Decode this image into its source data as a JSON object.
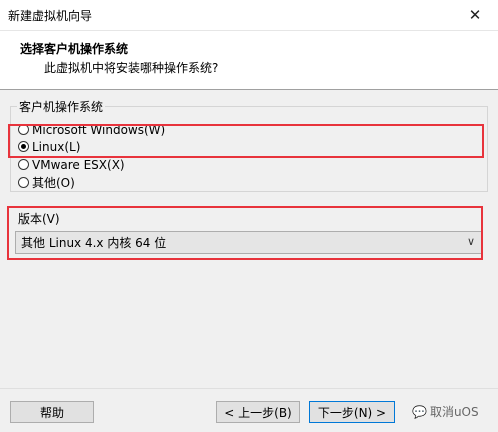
{
  "window": {
    "title": "新建虚拟机向导",
    "close_icon": "close-icon"
  },
  "header": {
    "title": "选择客户机操作系统",
    "subtitle": "此虚拟机中将安装哪种操作系统?"
  },
  "guest_os": {
    "legend": "客户机操作系统",
    "options": [
      {
        "label": "Microsoft Windows(W)",
        "checked": false
      },
      {
        "label": "Linux(L)",
        "checked": true
      },
      {
        "label": "VMware ESX(X)",
        "checked": false
      },
      {
        "label": "其他(O)",
        "checked": false
      }
    ]
  },
  "version": {
    "label": "版本(V)",
    "selected": "其他 Linux 4.x 内核 64 位"
  },
  "buttons": {
    "help": "帮助",
    "back": "< 上一步(B)",
    "next": "下一步(N) >"
  },
  "watermark": {
    "text": "取消uOS",
    "icon": "wechat-icon"
  },
  "colors": {
    "highlight": "#e8333c",
    "accent": "#0078d7"
  }
}
